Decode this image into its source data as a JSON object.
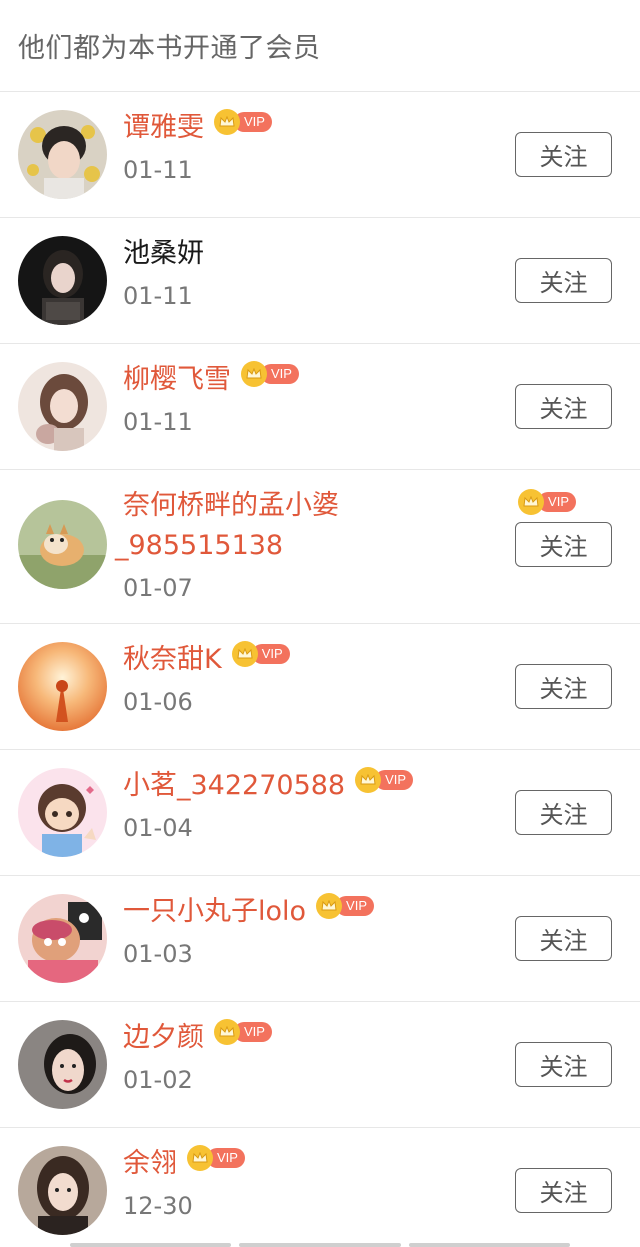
{
  "header": {
    "title": "他们都为本书开通了会员"
  },
  "vip_label": "VIP",
  "follow_label": "关注",
  "colors": {
    "accent": "#e0583a",
    "vip_badge": "#f3725d",
    "crown": "#f7c233"
  },
  "members": [
    {
      "name": "谭雅雯",
      "date": "01-11",
      "vip": true
    },
    {
      "name": "池桑妍",
      "date": "01-11",
      "vip": false
    },
    {
      "name": "柳樱飞雪",
      "date": "01-11",
      "vip": true
    },
    {
      "name": "奈何桥畔的孟小婆_985515138",
      "name_line1": "奈何桥畔的孟小婆",
      "name_line2": "_985515138",
      "date": "01-07",
      "vip": true
    },
    {
      "name": "秋奈甜K",
      "date": "01-06",
      "vip": true
    },
    {
      "name": "小茗_342270588",
      "date": "01-04",
      "vip": true
    },
    {
      "name": "一只小丸子lolo",
      "date": "01-03",
      "vip": true
    },
    {
      "name": "边夕颜",
      "date": "01-02",
      "vip": true
    },
    {
      "name": "余翎",
      "date": "12-30",
      "vip": true
    }
  ]
}
